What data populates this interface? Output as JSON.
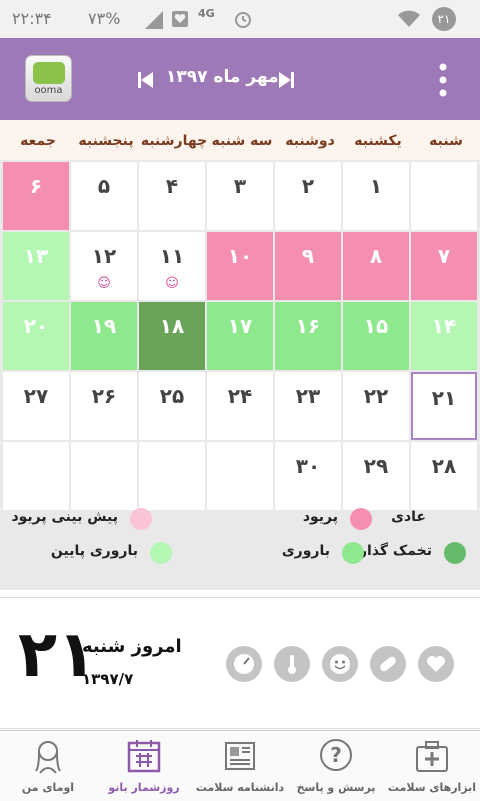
{
  "status_bar": {
    "time": "۲۲:۳۴",
    "battery": "۷۳%",
    "network": "4G",
    "notification_count": "۲۱"
  },
  "app_bar": {
    "logo_text": "ooma",
    "month_label": "مهر ماه ۱۳۹۷",
    "prev_icon": "skip-previous-icon",
    "next_icon": "skip-next-icon",
    "menu_icon": "overflow-menu-icon"
  },
  "weekdays": [
    "شنبه",
    "یکشنبه",
    "دوشنبه",
    "سه شنبه",
    "چهارشنبه",
    "پنجشنبه",
    "جمعه"
  ],
  "colors": {
    "period": "#f48fb1",
    "fertile": "#8ee88e",
    "fertile_low": "#b3f7b3",
    "ovulation": "#66bb6a",
    "ovulation_day": "#6aa35a",
    "predicted_period": "#fbc4d6",
    "today_border": "#a983c4",
    "accent": "#9d79b7"
  },
  "weeks": [
    [
      {
        "day": "",
        "type": "empty"
      },
      {
        "day": "۱",
        "type": "normal"
      },
      {
        "day": "۲",
        "type": "normal"
      },
      {
        "day": "۳",
        "type": "normal"
      },
      {
        "day": "۴",
        "type": "normal"
      },
      {
        "day": "۵",
        "type": "normal"
      },
      {
        "day": "۶",
        "type": "period"
      }
    ],
    [
      {
        "day": "۷",
        "type": "period"
      },
      {
        "day": "۸",
        "type": "period"
      },
      {
        "day": "۹",
        "type": "period"
      },
      {
        "day": "۱۰",
        "type": "period"
      },
      {
        "day": "۱۱",
        "type": "normal",
        "mood": "☺"
      },
      {
        "day": "۱۲",
        "type": "normal",
        "mood": "☺"
      },
      {
        "day": "۱۳",
        "type": "fertile_low"
      }
    ],
    [
      {
        "day": "۱۴",
        "type": "fertile_low"
      },
      {
        "day": "۱۵",
        "type": "fertile"
      },
      {
        "day": "۱۶",
        "type": "fertile"
      },
      {
        "day": "۱۷",
        "type": "fertile"
      },
      {
        "day": "۱۸",
        "type": "ovulation_day"
      },
      {
        "day": "۱۹",
        "type": "fertile"
      },
      {
        "day": "۲۰",
        "type": "fertile_low"
      }
    ],
    [
      {
        "day": "۲۱",
        "type": "today"
      },
      {
        "day": "۲۲",
        "type": "normal"
      },
      {
        "day": "۲۳",
        "type": "normal"
      },
      {
        "day": "۲۴",
        "type": "normal"
      },
      {
        "day": "۲۵",
        "type": "normal"
      },
      {
        "day": "۲۶",
        "type": "normal"
      },
      {
        "day": "۲۷",
        "type": "normal"
      }
    ],
    [
      {
        "day": "۲۸",
        "type": "normal"
      },
      {
        "day": "۲۹",
        "type": "normal"
      },
      {
        "day": "۳۰",
        "type": "normal"
      },
      {
        "day": "",
        "type": "empty"
      },
      {
        "day": "",
        "type": "empty"
      },
      {
        "day": "",
        "type": "empty"
      },
      {
        "day": "",
        "type": "empty"
      }
    ]
  ],
  "legend": [
    {
      "label": "عادی",
      "color_key": "none"
    },
    {
      "label": "پریود",
      "color_key": "period"
    },
    {
      "label": "پیش بینی پریود",
      "color_key": "predicted_period"
    },
    {
      "label": "تخمک گذاری",
      "color_key": "ovulation"
    },
    {
      "label": "باروری",
      "color_key": "fertile"
    },
    {
      "label": "باروری پایین",
      "color_key": "fertile_low"
    }
  ],
  "today": {
    "day_number": "۲۱",
    "title": "امروز شنبه",
    "date": "۱۳۹۷/۷"
  },
  "tools": [
    "heart-icon",
    "pill-icon",
    "mood-face-icon",
    "thermometer-icon",
    "scale-icon"
  ],
  "bottom_nav": [
    {
      "label": "ابزارهای سلامت",
      "icon": "medical-kit-icon"
    },
    {
      "label": "پرسش و پاسخ",
      "icon": "question-icon"
    },
    {
      "label": "دانشنامه سلامت",
      "icon": "newspaper-icon"
    },
    {
      "label": "روزشمار بانو",
      "icon": "calendar-icon",
      "active": true
    },
    {
      "label": "اومای من",
      "icon": "woman-profile-icon"
    }
  ]
}
